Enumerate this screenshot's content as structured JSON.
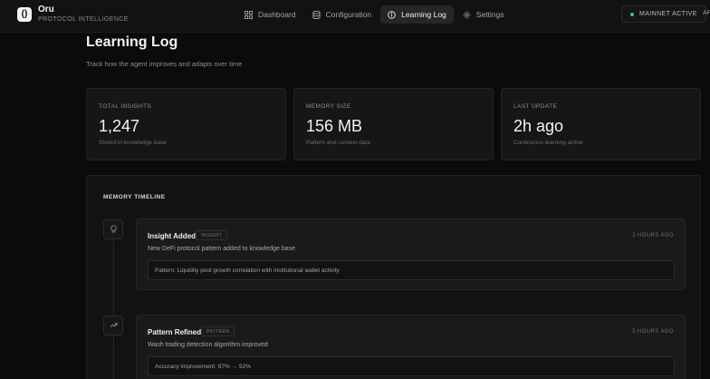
{
  "brand": {
    "name": "Oru",
    "subtitle": "PROTOCOL INTELLIGENCE",
    "logo_glyph": "()"
  },
  "nav": [
    {
      "label": "Dashboard",
      "icon": "grid-icon",
      "active": false
    },
    {
      "label": "Configuration",
      "icon": "database-icon",
      "active": false
    },
    {
      "label": "Learning Log",
      "icon": "info-circle-icon",
      "active": true
    },
    {
      "label": "Settings",
      "icon": "gear-icon",
      "active": false
    }
  ],
  "network": {
    "label": "MAINNET ACTIVE",
    "status_color": "#2bd18b"
  },
  "cut_text": "AP",
  "page": {
    "title": "Learning Log",
    "subtitle": "Track how the agent improves and adapts over time"
  },
  "stats": [
    {
      "label": "TOTAL INSIGHTS",
      "value": "1,247",
      "note": "Stored in knowledge base"
    },
    {
      "label": "MEMORY SIZE",
      "value": "156 MB",
      "note": "Pattern and context data"
    },
    {
      "label": "LAST UPDATE",
      "value": "2h ago",
      "note": "Continuous learning active"
    }
  ],
  "timeline": {
    "title": "MEMORY TIMELINE",
    "entries": [
      {
        "icon": "lightbulb-icon",
        "title": "Insight Added",
        "tag": "INSIGHT",
        "time": "2 HOURS AGO",
        "description": "New DeFi protocol pattern added to knowledge base",
        "detail": "Pattern: Liquidity pool growth correlation with institutional wallet activity"
      },
      {
        "icon": "trend-up-icon",
        "title": "Pattern Refined",
        "tag": "PATTERN",
        "time": "5 HOURS AGO",
        "description": "Wash trading detection algorithm improved",
        "detail": "Accuracy improvement: 87% → 92%"
      }
    ]
  }
}
